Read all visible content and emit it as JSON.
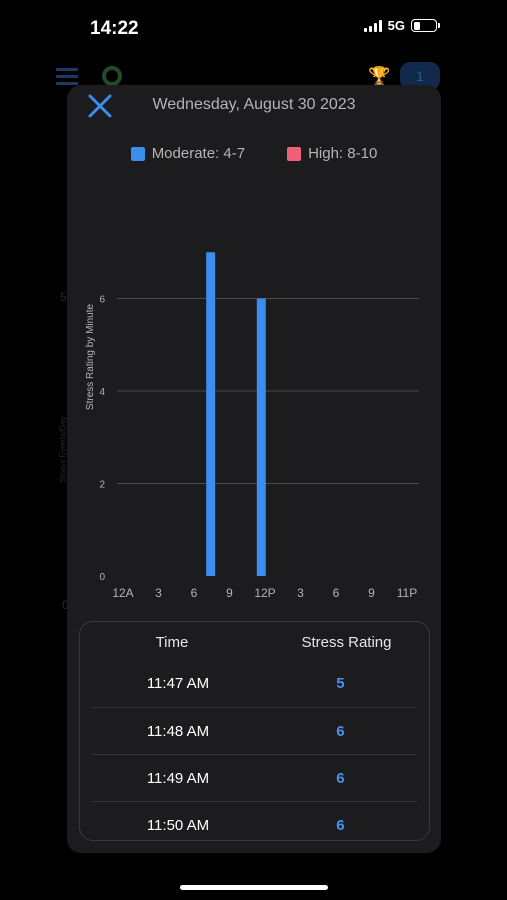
{
  "status_bar": {
    "time": "14:22",
    "network": "5G",
    "battery_level": 0.3
  },
  "background": {
    "badge": "1",
    "axis_top": "5",
    "axis_bottom": "0",
    "axis_label": "Stress Events/Day"
  },
  "modal": {
    "date": "Wednesday, August 30 2023",
    "legend": [
      {
        "label": "Moderate: 4-7",
        "color": "#3b8df0"
      },
      {
        "label": "High: 8-10",
        "color": "#f0607a"
      }
    ]
  },
  "chart_data": {
    "type": "bar",
    "ylabel": "Stress Rating by Minute",
    "ylim": [
      0,
      8
    ],
    "yticks": [
      0,
      2,
      4,
      6
    ],
    "xticks": [
      "12A",
      "3",
      "6",
      "9",
      "12P",
      "3",
      "6",
      "9",
      "11P"
    ],
    "xrange_hours": [
      0,
      23
    ],
    "bars": [
      {
        "hour": 7.1,
        "value": 7
      },
      {
        "hour": 11.2,
        "value": 6
      }
    ],
    "bar_color": "#3b8df0",
    "grid": true
  },
  "table": {
    "headers": {
      "time": "Time",
      "rating": "Stress Rating"
    },
    "rows": [
      {
        "time": "11:47 AM",
        "rating": "5"
      },
      {
        "time": "11:48 AM",
        "rating": "6"
      },
      {
        "time": "11:49 AM",
        "rating": "6"
      },
      {
        "time": "11:50 AM",
        "rating": "6"
      }
    ]
  }
}
